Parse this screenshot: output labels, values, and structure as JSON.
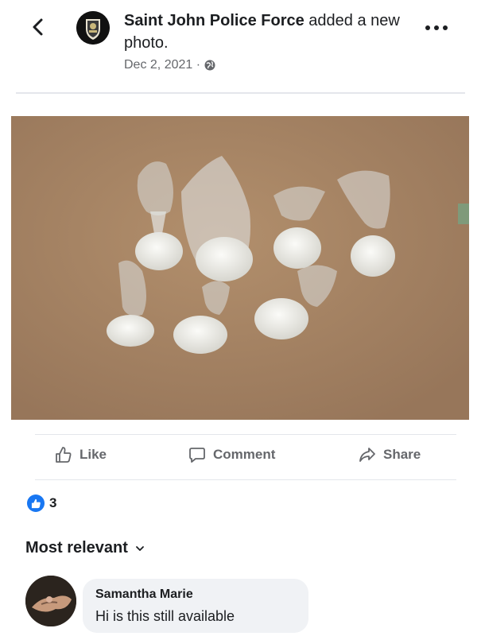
{
  "header": {
    "author": "Saint John Police Force",
    "action": " added a new photo.",
    "date": "Dec 2, 2021 ·",
    "privacy_icon": "globe-icon",
    "back_icon": "chevron-left-icon",
    "more_icon": "more-horizontal-icon"
  },
  "photo": {
    "background_color": "#a78665",
    "items_count": 8
  },
  "actions": {
    "like_label": "Like",
    "comment_label": "Comment",
    "share_label": "Share"
  },
  "reactions": {
    "icon": "thumbs-up-icon",
    "count": "3",
    "color": "#1877f2"
  },
  "sort": {
    "label": "Most relevant"
  },
  "comments": [
    {
      "name": "Samantha Marie",
      "text": "Hi is this still available"
    }
  ]
}
